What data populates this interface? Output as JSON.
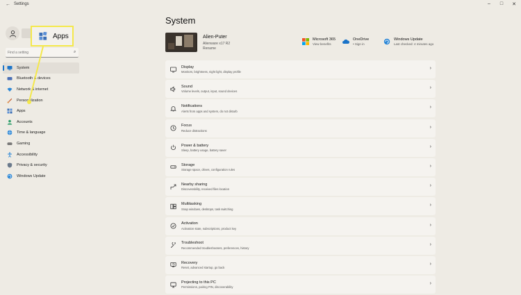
{
  "window": {
    "title": "Settings",
    "back": "←",
    "minimize": "–",
    "maximize": "□",
    "close": "✕"
  },
  "sidebar": {
    "search_placeholder": "Find a setting",
    "items": [
      {
        "label": "System",
        "icon": "monitor-icon",
        "active": true
      },
      {
        "label": "Bluetooth & devices",
        "icon": "bluetooth-icon"
      },
      {
        "label": "Network & internet",
        "icon": "wifi-icon"
      },
      {
        "label": "Personalization",
        "icon": "brush-icon"
      },
      {
        "label": "Apps",
        "icon": "apps-icon"
      },
      {
        "label": "Accounts",
        "icon": "person-icon"
      },
      {
        "label": "Time & language",
        "icon": "globe-icon"
      },
      {
        "label": "Gaming",
        "icon": "gamepad-icon"
      },
      {
        "label": "Accessibility",
        "icon": "accessibility-icon"
      },
      {
        "label": "Privacy & security",
        "icon": "shield-icon"
      },
      {
        "label": "Windows Update",
        "icon": "update-icon"
      }
    ]
  },
  "callout": {
    "label": "Apps",
    "icon": "apps-icon",
    "highlight_color": "#f4e84a"
  },
  "main": {
    "title": "System",
    "device": {
      "name": "Alien-Puter",
      "model": "Alienware x17 R2",
      "rename": "Rename"
    },
    "quick_links": [
      {
        "title": "Microsoft 365",
        "subtitle": "View benefits",
        "icon": "microsoft-logo-icon"
      },
      {
        "title": "OneDrive",
        "subtitle": "• Sign in",
        "icon": "cloud-icon"
      },
      {
        "title": "Windows Update",
        "subtitle": "Last checked: 4 minutes ago",
        "icon": "update-icon"
      }
    ],
    "cards": [
      {
        "title": "Display",
        "subtitle": "Monitors, brightness, night light, display profile",
        "icon": "monitor-icon"
      },
      {
        "title": "Sound",
        "subtitle": "Volume levels, output, input, sound devices",
        "icon": "speaker-icon"
      },
      {
        "title": "Notifications",
        "subtitle": "Alerts from apps and system, do not disturb",
        "icon": "bell-icon"
      },
      {
        "title": "Focus",
        "subtitle": "Reduce distractions",
        "icon": "focus-icon"
      },
      {
        "title": "Power & battery",
        "subtitle": "Sleep, battery usage, battery saver",
        "icon": "power-icon"
      },
      {
        "title": "Storage",
        "subtitle": "Storage space, drives, configuration rules",
        "icon": "storage-icon"
      },
      {
        "title": "Nearby sharing",
        "subtitle": "Discoverability, received files location",
        "icon": "share-icon"
      },
      {
        "title": "Multitasking",
        "subtitle": "Snap windows, desktops, task switching",
        "icon": "multitask-icon"
      },
      {
        "title": "Activation",
        "subtitle": "Activation state, subscriptions, product key",
        "icon": "check-circle-icon"
      },
      {
        "title": "Troubleshoot",
        "subtitle": "Recommended troubleshooters, preferences, history",
        "icon": "wrench-icon"
      },
      {
        "title": "Recovery",
        "subtitle": "Reset, advanced startup, go back",
        "icon": "recovery-icon"
      },
      {
        "title": "Projecting to this PC",
        "subtitle": "Permissions, pairing PIN, discoverability",
        "icon": "project-icon"
      }
    ],
    "chevron": "›"
  },
  "colors": {
    "accent": "#1a73c8",
    "background": "#eeebe4",
    "card": "#f5f3ef"
  }
}
